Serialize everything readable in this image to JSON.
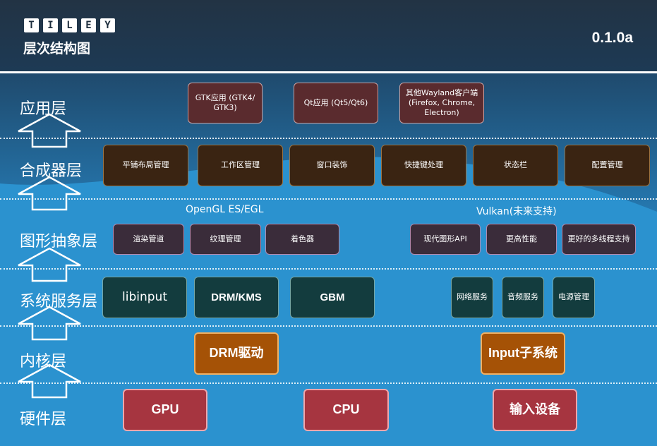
{
  "header": {
    "logo_letters": [
      "T",
      "I",
      "L",
      "E",
      "Y"
    ],
    "subtitle": "层次结构图",
    "version": "0.1.0a"
  },
  "layers": {
    "app": "应用层",
    "compositor": "合成器层",
    "graphics": "图形抽象层",
    "system": "系统服务层",
    "kernel": "内核层",
    "hardware": "硬件层"
  },
  "apps": {
    "gtk": "GTK应用 (GTK4/ GTK3)",
    "qt": "Qt应用 (Qt5/Qt6)",
    "wayland": "其他Wayland客户端 (Firefox, Chrome, Electron)"
  },
  "compositor": [
    "平铺布局管理",
    "工作区管理",
    "窗口装饰",
    "快捷键处理",
    "状态栏",
    "配置管理"
  ],
  "graphics": {
    "opengl_title": "OpenGL ES/EGL",
    "vulkan_title": "Vulkan(未来支持)",
    "opengl_items": [
      "渲染管道",
      "纹理管理",
      "着色器"
    ],
    "vulkan_items": [
      "现代图形API",
      "更高性能",
      "更好的多线程支持"
    ]
  },
  "system": {
    "main": [
      "libinput",
      "DRM/KMS",
      "GBM"
    ],
    "aux": [
      "网络服务",
      "音频服务",
      "电源管理"
    ]
  },
  "kernel": [
    "DRM驱动",
    "Input子系统"
  ],
  "hardware": [
    "GPU",
    "CPU",
    "输入设备"
  ],
  "colors": {
    "background": "#2a8fcd",
    "header": "#1d3a55",
    "app_box": "#5a2b2e",
    "compositor_box": "#3a2412",
    "graphics_box": "#3a2c3a",
    "system_box": "#133c3e",
    "kernel_box": "#a55206",
    "hardware_box": "#a63540"
  },
  "icons": {
    "layer_arrow": "up-arrow-icon"
  }
}
